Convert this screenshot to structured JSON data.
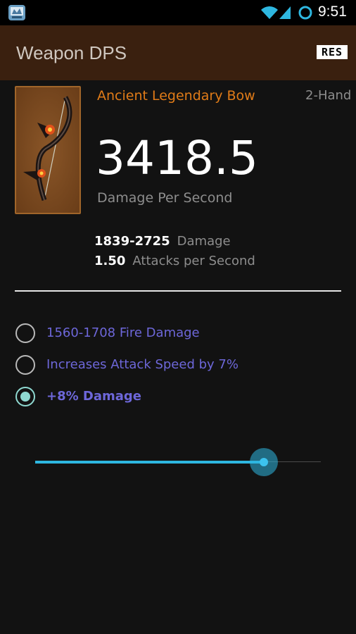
{
  "status_bar": {
    "time": "9:51",
    "icons": [
      "app-notification-icon",
      "wifi-icon",
      "cell-signal-icon",
      "sync-ring-icon"
    ]
  },
  "app_bar": {
    "title": "Weapon DPS",
    "logo_text": "RES"
  },
  "weapon": {
    "name": "Ancient Legendary Bow",
    "hand": "2-Hand",
    "dps": "3418.5",
    "dps_label": "Damage Per Second",
    "damage_value": "1839-2725",
    "damage_label": "Damage",
    "aps_value": "1.50",
    "aps_label": "Attacks per Second",
    "image": "bow-icon"
  },
  "options": [
    {
      "label": "1560-1708 Fire Damage",
      "checked": false
    },
    {
      "label": "Increases Attack Speed by 7%",
      "checked": false
    },
    {
      "label": "+8% Damage",
      "checked": true
    }
  ],
  "slider": {
    "fraction": 0.8
  },
  "colors": {
    "app_bar": "#3a200f",
    "weapon_name": "#e07b18",
    "option_text": "#6d67d9",
    "accent": "#2eb7e0",
    "radio_checked": "#8fd9d1"
  }
}
